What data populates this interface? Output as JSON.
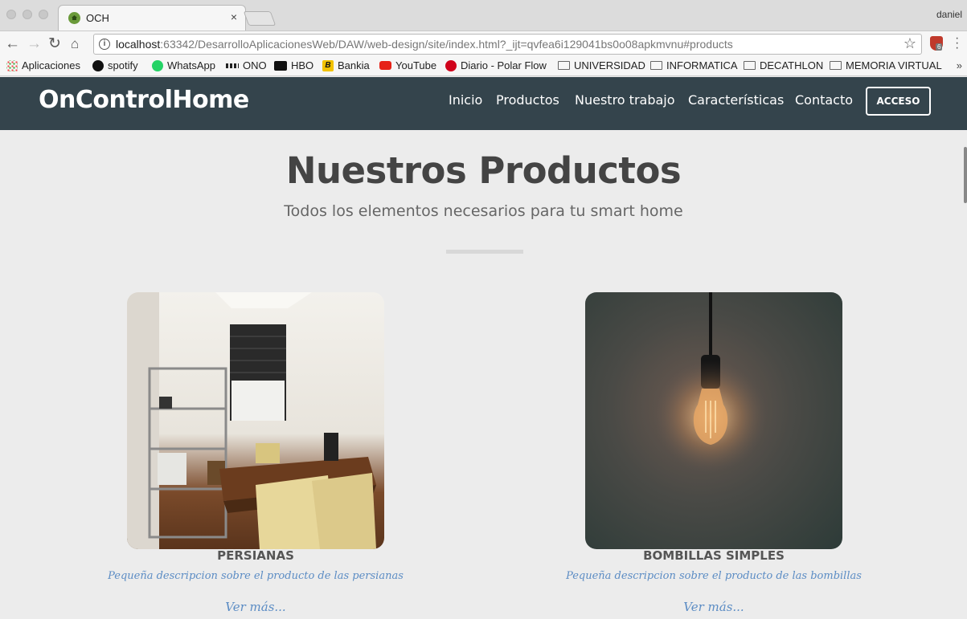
{
  "browser": {
    "tab_title": "OCH",
    "tab_close": "×",
    "user_name": "daniel",
    "url_host": "localhost",
    "url_rest": ":63342/DesarrolloAplicacionesWeb/DAW/web-design/site/index.html?_ijt=qvfea6i129041bs0o08apkmvnu#products",
    "ext_badge": "6",
    "bookmarks": [
      {
        "label": "Aplicaciones",
        "icon": "apps-grid-icon"
      },
      {
        "label": "spotify",
        "icon": "spotify-icon"
      },
      {
        "label": "WhatsApp",
        "icon": "whatsapp-icon"
      },
      {
        "label": "ONO",
        "icon": "ono-icon"
      },
      {
        "label": "HBO",
        "icon": "hbo-icon"
      },
      {
        "label": "Bankia",
        "icon": "bankia-icon"
      },
      {
        "label": "YouTube",
        "icon": "youtube-icon"
      },
      {
        "label": "Diario - Polar Flow",
        "icon": "polar-icon"
      },
      {
        "label": "UNIVERSIDAD",
        "icon": "folder-icon"
      },
      {
        "label": "INFORMATICA",
        "icon": "folder-icon"
      },
      {
        "label": "DECATHLON",
        "icon": "folder-icon"
      },
      {
        "label": "MEMORIA VIRTUAL",
        "icon": "folder-icon"
      }
    ],
    "bookmarks_more": "»"
  },
  "site": {
    "logo": "OnControlHome",
    "nav": [
      "Inicio",
      "Productos",
      "Nuestro trabajo",
      "Características",
      "Contacto"
    ],
    "login": "ACCESO"
  },
  "products_section": {
    "title": "Nuestros Productos",
    "subtitle": "Todos los elementos necesarios para tu smart home",
    "items": [
      {
        "name": "PERSIANAS",
        "description": "Pequeña descripcion sobre el producto de las persianas",
        "more": "Ver más..."
      },
      {
        "name": "BOMBILLAS SIMPLES",
        "description": "Pequeña descripcion sobre el producto de las bombillas",
        "more": "Ver más..."
      }
    ]
  },
  "colors": {
    "header_bg": "#34444c",
    "page_bg": "#ececec",
    "link": "#5b8cc4"
  }
}
